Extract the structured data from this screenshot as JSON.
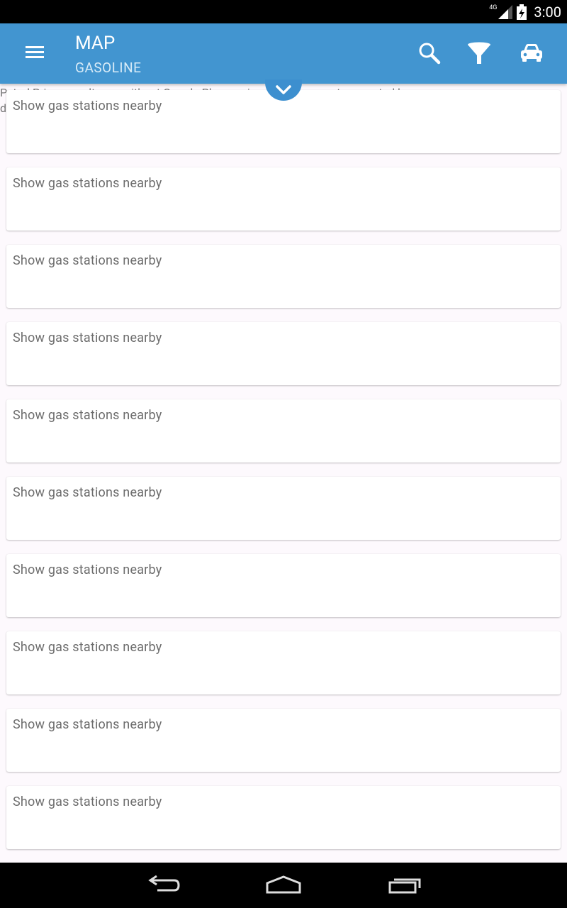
{
  "status_bar": {
    "network": "4G",
    "time": "3:00"
  },
  "app_bar": {
    "title": "MAP",
    "subtitle": "GASOLINE"
  },
  "background_notice": {
    "line1": "Petrol Prices results are without Google Play services, which are not supported by",
    "line2": "d"
  },
  "list": {
    "items": [
      {
        "label": "Show gas stations nearby"
      },
      {
        "label": "Show gas stations nearby"
      },
      {
        "label": "Show gas stations nearby"
      },
      {
        "label": "Show gas stations nearby"
      },
      {
        "label": "Show gas stations nearby"
      },
      {
        "label": "Show gas stations nearby"
      },
      {
        "label": "Show gas stations nearby"
      },
      {
        "label": "Show gas stations nearby"
      },
      {
        "label": "Show gas stations nearby"
      },
      {
        "label": "Show gas stations nearby"
      }
    ]
  },
  "icons": {
    "menu": "hamburger-menu-icon",
    "search": "search-icon",
    "filter": "filter-funnel-icon",
    "car": "car-icon",
    "pull": "chevron-down-icon",
    "back": "back-icon",
    "home": "home-icon",
    "recents": "recents-icon"
  },
  "colors": {
    "primary": "#4295d0",
    "status_bar": "#000000",
    "background": "#fdf9fd"
  }
}
